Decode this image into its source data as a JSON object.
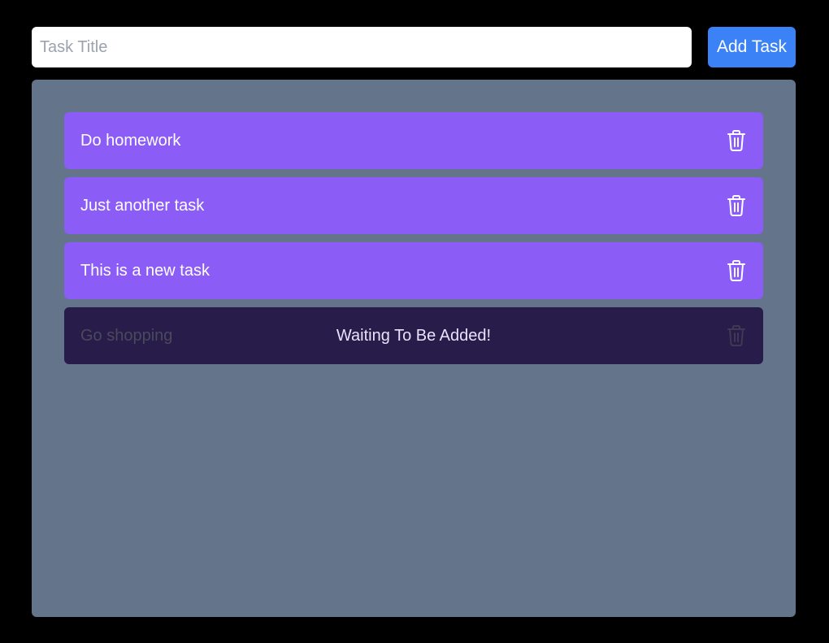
{
  "form": {
    "input_placeholder": "Task Title",
    "input_value": "",
    "add_button_label": "Add Task"
  },
  "tasks": [
    {
      "title": "Do homework",
      "icon": "trash-icon",
      "status": "added"
    },
    {
      "title": "Just another task",
      "icon": "trash-icon",
      "status": "added"
    },
    {
      "title": "This is a new task",
      "icon": "trash-icon",
      "status": "added"
    },
    {
      "title": "Go shopping",
      "icon": "trash-icon",
      "status": "pending"
    }
  ],
  "pending_message": "Waiting To Be Added!",
  "colors": {
    "page_background": "#000000",
    "board_background": "#64748b",
    "task_background": "#8b5cf6",
    "pending_task_background": "#271c4a",
    "add_button": "#3b82f6"
  }
}
